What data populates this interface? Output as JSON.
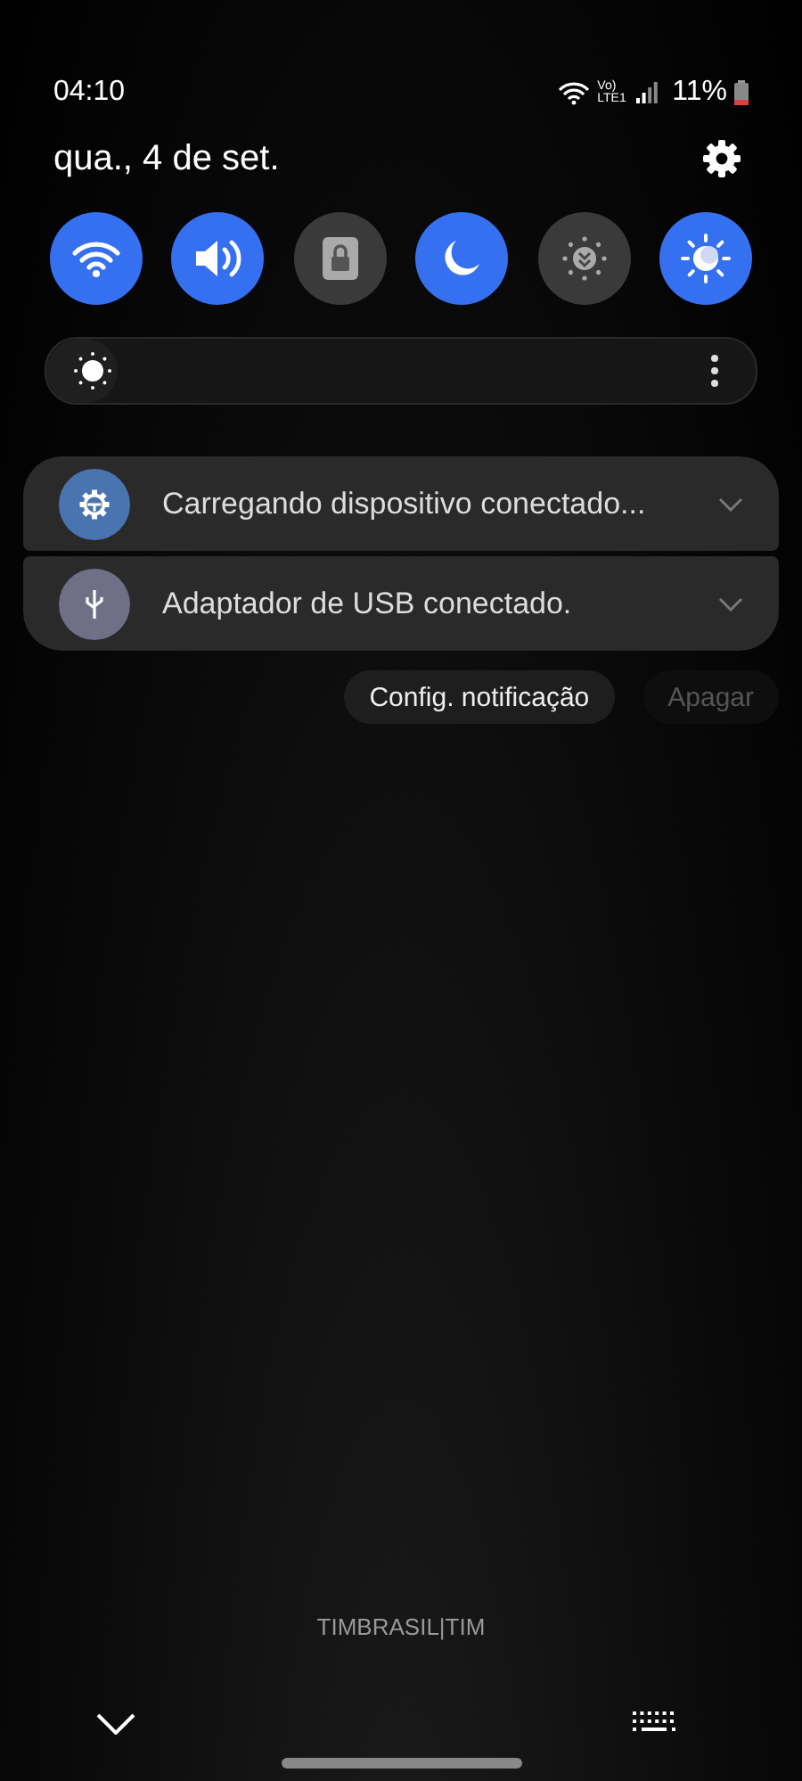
{
  "status_bar": {
    "time": "04:10",
    "network_label": "Vo) LTE1",
    "battery": "11%"
  },
  "date": "qua., 4 de set.",
  "brightness": {
    "level": 0.1
  },
  "toggles": [
    {
      "kind": "wifi",
      "on": true
    },
    {
      "kind": "sound",
      "on": true
    },
    {
      "kind": "lock",
      "on": false
    },
    {
      "kind": "moon",
      "on": true
    },
    {
      "kind": "eye",
      "on": false
    },
    {
      "kind": "sun",
      "on": true
    }
  ],
  "notifications": [
    {
      "kind": "gear",
      "color": "#4a74b0",
      "text": "Carregando dispositivo conectado..."
    },
    {
      "kind": "usb",
      "color": "#6f7086",
      "text": "Adaptador de USB conectado."
    }
  ],
  "actions": [
    {
      "label": "Config. notificação",
      "disabled": false
    },
    {
      "label": "Apagar",
      "disabled": true
    }
  ],
  "carrier": "TIMBRASIL|TIM"
}
